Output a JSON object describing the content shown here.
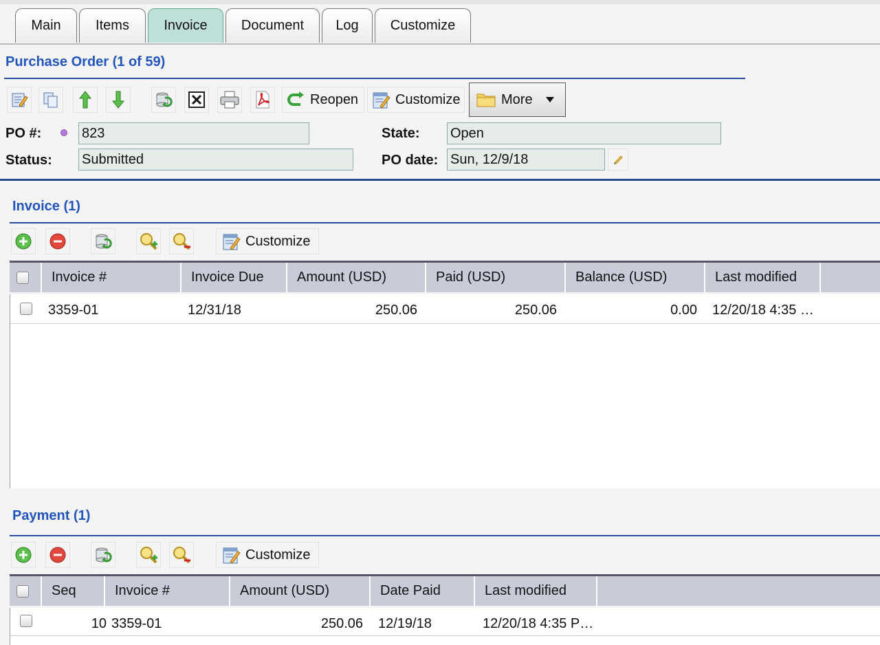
{
  "tabs": [
    "Main",
    "Items",
    "Invoice",
    "Document",
    "Log",
    "Customize"
  ],
  "active_tab": "Invoice",
  "purchase_order": {
    "title": "Purchase Order (1 of 59)",
    "toolbar": {
      "reopen_label": "Reopen",
      "customize_label": "Customize",
      "more_label": "More"
    },
    "fields": {
      "po_label": "PO #:",
      "po_value": "823",
      "status_label": "Status:",
      "status_value": "Submitted",
      "state_label": "State:",
      "state_value": "Open",
      "po_date_label": "PO date:",
      "po_date_value": "Sun, 12/9/18"
    }
  },
  "invoice_section": {
    "title": "Invoice (1)",
    "customize_label": "Customize",
    "columns": [
      "Invoice #",
      "Invoice Due",
      "Amount (USD)",
      "Paid (USD)",
      "Balance (USD)",
      "Last modified"
    ],
    "rows": [
      {
        "invoice_no": "3359-01",
        "due": "12/31/18",
        "amount": "250.06",
        "paid": "250.06",
        "balance": "0.00",
        "last_modified": "12/20/18 4:35 …"
      }
    ]
  },
  "payment_section": {
    "title": "Payment (1)",
    "customize_label": "Customize",
    "columns": [
      "Seq",
      "Invoice #",
      "Amount (USD)",
      "Date Paid",
      "Last modified"
    ],
    "rows": [
      {
        "seq": "10",
        "invoice_no": "3359-01",
        "amount": "250.06",
        "date_paid": "12/19/18",
        "last_modified": "12/20/18 4:35 P…"
      }
    ]
  }
}
